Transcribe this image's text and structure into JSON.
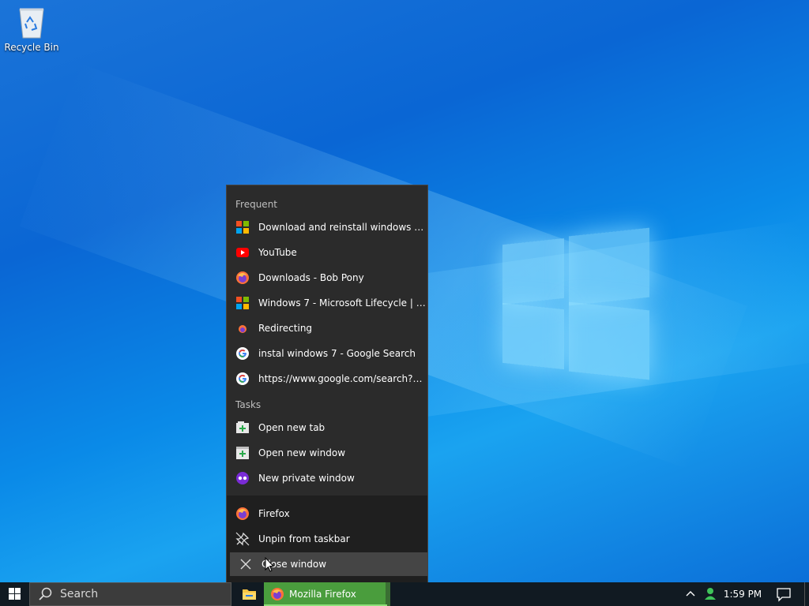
{
  "desktop": {
    "icons": [
      {
        "label": "Recycle Bin",
        "icon": "recycle-bin-icon"
      }
    ]
  },
  "jumplist": {
    "frequent_header": "Frequent",
    "frequent": [
      {
        "label": "Download and reinstall windows 7 ho...",
        "icon": "microsoft-icon"
      },
      {
        "label": "YouTube",
        "icon": "youtube-icon"
      },
      {
        "label": "Downloads - Bob Pony",
        "icon": "firefox-icon"
      },
      {
        "label": "Windows 7 - Microsoft Lifecycle | Micr...",
        "icon": "microsoft-icon"
      },
      {
        "label": "Redirecting",
        "icon": "firefox-small-icon"
      },
      {
        "label": "instal windows 7 - Google Search",
        "icon": "google-icon"
      },
      {
        "label": "https://www.google.com/search?q=ins...",
        "icon": "google-icon"
      }
    ],
    "tasks_header": "Tasks",
    "tasks": [
      {
        "label": "Open new tab",
        "icon": "new-tab-icon"
      },
      {
        "label": "Open new window",
        "icon": "new-window-icon"
      },
      {
        "label": "New private window",
        "icon": "private-window-icon"
      }
    ],
    "app": [
      {
        "label": "Firefox",
        "icon": "firefox-icon"
      },
      {
        "label": "Unpin from taskbar",
        "icon": "unpin-icon"
      },
      {
        "label": "Close window",
        "icon": "close-icon"
      }
    ]
  },
  "taskbar": {
    "search_placeholder": "Search",
    "firefox_label": "Mozilla Firefox",
    "clock": "1:59 PM",
    "accent": "#4a9d3d"
  }
}
